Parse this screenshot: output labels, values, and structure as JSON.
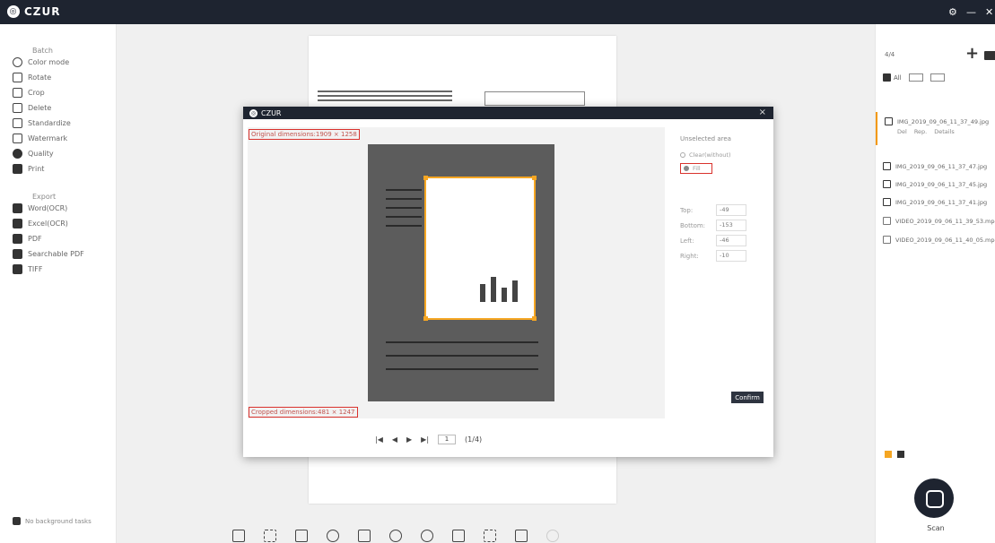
{
  "app": {
    "title": "CZUR",
    "controls": [
      "⚙",
      "—",
      "✕"
    ]
  },
  "left_panel": {
    "batch_title": "Batch",
    "batch_items": [
      {
        "label": "Color mode",
        "icon": "color-mode-icon"
      },
      {
        "label": "Rotate",
        "icon": "rotate-icon"
      },
      {
        "label": "Crop",
        "icon": "crop-icon"
      },
      {
        "label": "Delete",
        "icon": "delete-icon"
      },
      {
        "label": "Standardize",
        "icon": "standardize-icon"
      },
      {
        "label": "Watermark",
        "icon": "watermark-icon"
      },
      {
        "label": "Quality",
        "icon": "quality-icon"
      },
      {
        "label": "Print",
        "icon": "print-icon"
      }
    ],
    "export_title": "Export",
    "export_items": [
      {
        "label": "Word(OCR)",
        "icon": "word-icon"
      },
      {
        "label": "Excel(OCR)",
        "icon": "excel-icon"
      },
      {
        "label": "PDF",
        "icon": "pdf-icon"
      },
      {
        "label": "Searchable PDF",
        "icon": "searchable-pdf-icon"
      },
      {
        "label": "TIFF",
        "icon": "tiff-icon"
      }
    ],
    "bottom_link": "No background tasks"
  },
  "dialog": {
    "title": "CZUR",
    "close": "×",
    "original_dimensions": "Original dimensions:1909 × 1258",
    "cropped_dimensions": "Cropped dimensions:481 × 1247",
    "side_title": "Unselected area",
    "option_clear": "Clear(without)",
    "option_fill": "Fill",
    "fields": [
      {
        "label": "Top:",
        "value": "-49"
      },
      {
        "label": "Bottom:",
        "value": "-153"
      },
      {
        "label": "Left:",
        "value": "-46"
      },
      {
        "label": "Right:",
        "value": "-10"
      }
    ],
    "confirm_label": "Confirm",
    "nav": {
      "first": "|◀",
      "prev": "◀",
      "next": "▶",
      "last": "▶|",
      "page": "1",
      "total": "(1/4)"
    }
  },
  "right_panel": {
    "header": "4/4",
    "filters": [
      "All"
    ],
    "files": [
      {
        "name": "IMG_2019_09_06_11_37_49.jpg",
        "checked": true
      },
      {
        "name": "IMG_2019_09_06_11_37_47.jpg",
        "checked": true
      },
      {
        "name": "IMG_2019_09_06_11_37_45.jpg",
        "checked": true
      },
      {
        "name": "IMG_2019_09_06_11_37_41.jpg",
        "checked": true
      },
      {
        "name": "VIDEO_2019_09_06_11_39_53.mp4",
        "checked": false
      },
      {
        "name": "VIDEO_2019_09_06_11_40_05.mp4",
        "checked": false
      }
    ],
    "file_actions": [
      "Del",
      "Rep.",
      "Details"
    ],
    "scan_label": "Scan"
  },
  "colors": {
    "accent": "#f5a623",
    "dark": "#1e2430",
    "highlight_red": "#d9322d"
  }
}
